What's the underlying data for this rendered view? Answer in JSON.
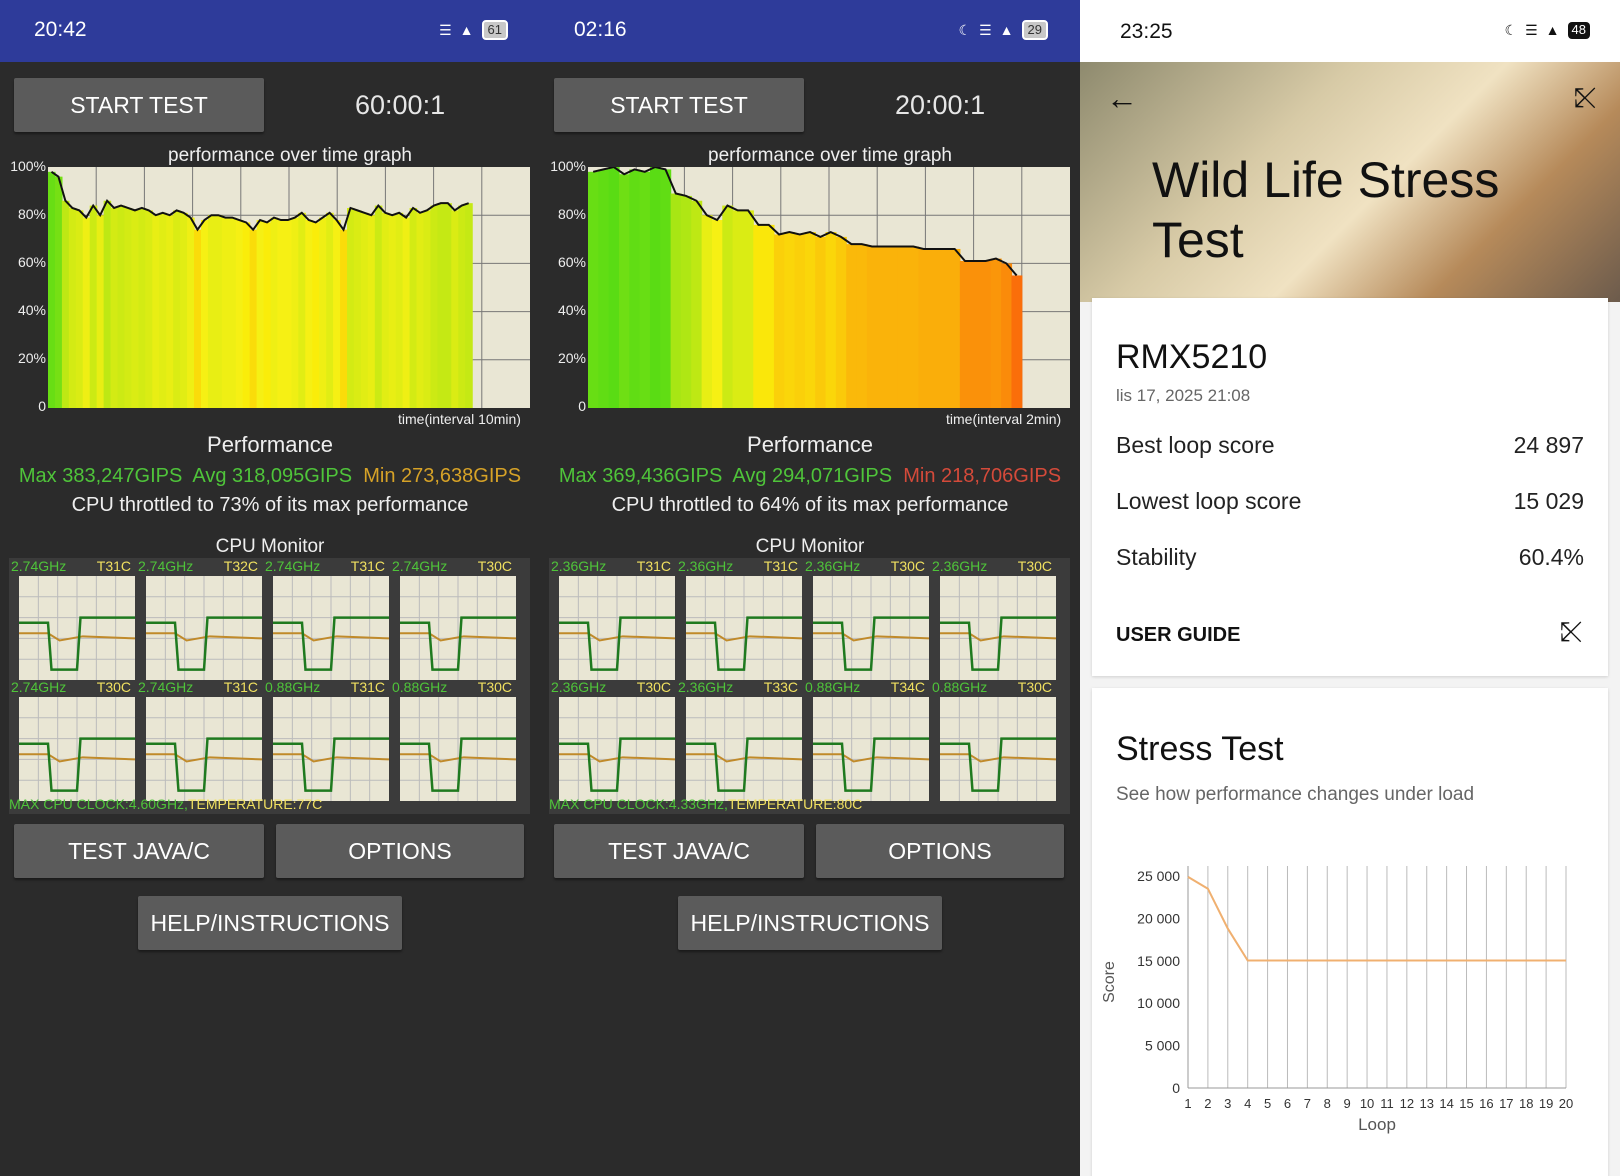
{
  "panels": [
    {
      "status_time": "20:42",
      "battery": "61",
      "start_button": "START TEST",
      "timer": "60:00:1",
      "graph_title": "performance over time graph",
      "y_labels": [
        "100%",
        "80%",
        "60%",
        "40%",
        "20%",
        "0"
      ],
      "x_caption": "time(interval 10min)",
      "perf_title": "Performance",
      "max": "Max 383,247GIPS",
      "avg": "Avg 318,095GIPS",
      "min": "Min 273,638GIPS",
      "min_color": "#d6a227",
      "throttle": "CPU throttled to 73% of its max performance",
      "cpu_title": "CPU Monitor",
      "cores": [
        {
          "freq": "2.74GHz",
          "temp": "T31C"
        },
        {
          "freq": "2.74GHz",
          "temp": "T32C"
        },
        {
          "freq": "2.74GHz",
          "temp": "T31C"
        },
        {
          "freq": "2.74GHz",
          "temp": "T30C"
        },
        {
          "freq": "2.74GHz",
          "temp": "T30C"
        },
        {
          "freq": "2.74GHz",
          "temp": "T31C"
        },
        {
          "freq": "0.88GHz",
          "temp": "T31C"
        },
        {
          "freq": "0.88GHz",
          "temp": "T30C"
        }
      ],
      "max_clock": "MAX CPU CLOCK:4.60GHz,",
      "temperature": "TEMPERATURE:77C",
      "java_button": "TEST JAVA/C",
      "options_button": "OPTIONS",
      "help_button": "HELP/INSTRUCTIONS"
    },
    {
      "status_time": "02:16",
      "battery": "29",
      "start_button": "START TEST",
      "timer": "20:00:1",
      "graph_title": "performance over time graph",
      "y_labels": [
        "100%",
        "80%",
        "60%",
        "40%",
        "20%",
        "0"
      ],
      "x_caption": "time(interval 2min)",
      "perf_title": "Performance",
      "max": "Max 369,436GIPS",
      "avg": "Avg 294,071GIPS",
      "min": "Min 218,706GIPS",
      "min_color": "#d44a3a",
      "throttle": "CPU throttled to 64% of its max performance",
      "cpu_title": "CPU Monitor",
      "cores": [
        {
          "freq": "2.36GHz",
          "temp": "T31C"
        },
        {
          "freq": "2.36GHz",
          "temp": "T31C"
        },
        {
          "freq": "2.36GHz",
          "temp": "T30C"
        },
        {
          "freq": "2.36GHz",
          "temp": "T30C"
        },
        {
          "freq": "2.36GHz",
          "temp": "T30C"
        },
        {
          "freq": "2.36GHz",
          "temp": "T33C"
        },
        {
          "freq": "0.88GHz",
          "temp": "T34C"
        },
        {
          "freq": "0.88GHz",
          "temp": "T30C"
        }
      ],
      "max_clock": "MAX CPU CLOCK:4.33GHz,",
      "temperature": "TEMPERATURE:80C",
      "java_button": "TEST JAVA/C",
      "options_button": "OPTIONS",
      "help_button": "HELP/INSTRUCTIONS"
    }
  ],
  "stress": {
    "status_time": "23:25",
    "battery": "48",
    "title": "Wild Life Stress Test",
    "device": "RMX5210",
    "date": "lis 17, 2025 21:08",
    "rows": [
      {
        "label": "Best loop score",
        "value": "24 897"
      },
      {
        "label": "Lowest loop score",
        "value": "15 029"
      },
      {
        "label": "Stability",
        "value": "60.4%"
      }
    ],
    "user_guide": "USER GUIDE",
    "section_title": "Stress Test",
    "section_subtitle": "See how performance changes under load"
  },
  "chart_data": [
    {
      "type": "area",
      "title": "performance over time graph",
      "xlabel": "time(interval 10min)",
      "ylim": [
        0,
        100
      ],
      "y_ticks": [
        "0",
        "20%",
        "40%",
        "60%",
        "80%",
        "100%"
      ],
      "values": [
        98,
        96,
        86,
        83,
        82,
        79,
        84,
        80,
        86,
        83,
        84,
        83,
        82,
        83,
        82,
        80,
        81,
        80,
        82,
        81,
        79,
        74,
        78,
        80,
        80,
        79,
        79,
        78,
        77,
        74,
        78,
        77,
        79,
        78,
        78,
        79,
        81,
        78,
        77,
        79,
        81,
        78,
        74,
        83,
        82,
        81,
        80,
        84,
        81,
        80,
        81,
        79,
        83,
        81,
        82,
        84,
        85,
        85,
        82,
        84,
        85
      ]
    },
    {
      "type": "area",
      "title": "performance over time graph",
      "xlabel": "time(interval 2min)",
      "ylim": [
        0,
        100
      ],
      "y_ticks": [
        "0",
        "20%",
        "40%",
        "60%",
        "80%",
        "100%"
      ],
      "values": [
        98,
        99,
        100,
        97,
        99,
        98,
        100,
        99,
        89,
        88,
        86,
        80,
        78,
        84,
        82,
        82,
        76,
        76,
        72,
        73,
        72,
        73,
        71,
        73,
        71,
        68,
        68,
        67,
        67,
        67,
        67,
        67,
        66,
        66,
        66,
        66,
        61,
        61,
        61,
        62,
        60,
        55
      ]
    },
    {
      "type": "line",
      "title": "",
      "xlabel": "Loop",
      "ylabel": "Score",
      "ylim": [
        0,
        25000
      ],
      "y_ticks": [
        "0",
        "5 000",
        "10 000",
        "15 000",
        "20 000",
        "25 000"
      ],
      "categories": [
        "1",
        "2",
        "3",
        "4",
        "5",
        "6",
        "7",
        "8",
        "9",
        "10",
        "11",
        "12",
        "13",
        "14",
        "15",
        "16",
        "17",
        "18",
        "19",
        "20"
      ],
      "values": [
        24897,
        23500,
        18800,
        15029,
        15029,
        15029,
        15029,
        15029,
        15029,
        15029,
        15029,
        15029,
        15029,
        15029,
        15029,
        15029,
        15029,
        15029,
        15029,
        15029
      ],
      "color": "#f0b070"
    }
  ]
}
